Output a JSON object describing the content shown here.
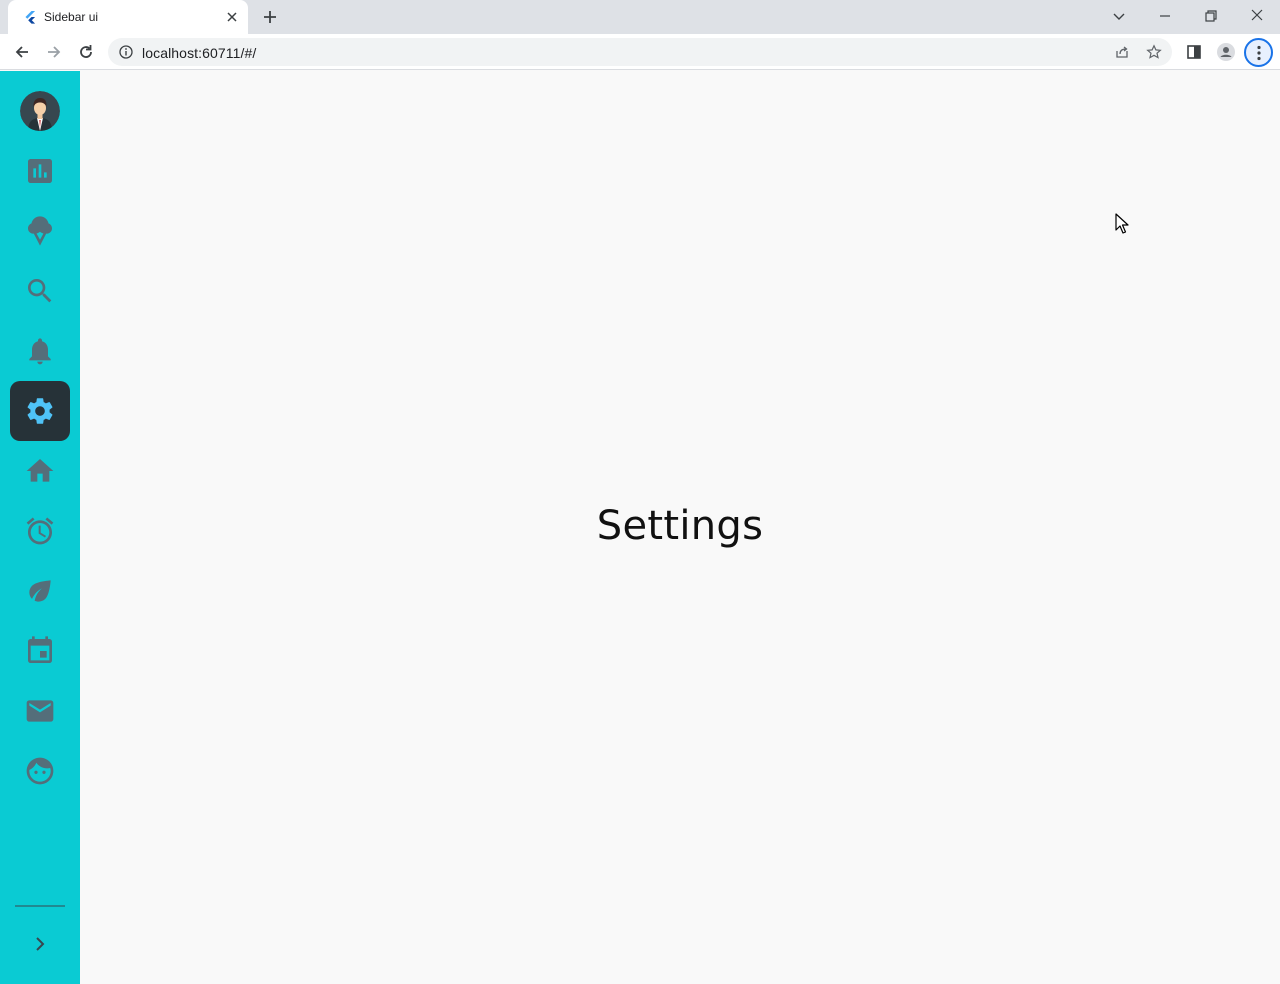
{
  "browser": {
    "tab_title": "Sidebar ui",
    "url": "localhost:60711/#/"
  },
  "sidebar": {
    "items": [
      {
        "name": "analytics",
        "icon": "bar-chart-icon",
        "active": false
      },
      {
        "name": "ice-cream",
        "icon": "ice-cream-icon",
        "active": false
      },
      {
        "name": "search",
        "icon": "search-icon",
        "active": false
      },
      {
        "name": "notifications",
        "icon": "bell-icon",
        "active": false
      },
      {
        "name": "settings",
        "icon": "gear-icon",
        "active": true
      },
      {
        "name": "home",
        "icon": "home-icon",
        "active": false
      },
      {
        "name": "alarm",
        "icon": "alarm-icon",
        "active": false
      },
      {
        "name": "eco",
        "icon": "leaf-icon",
        "active": false
      },
      {
        "name": "calendar",
        "icon": "calendar-icon",
        "active": false
      },
      {
        "name": "mail",
        "icon": "mail-icon",
        "active": false
      },
      {
        "name": "face",
        "icon": "face-icon",
        "active": false
      }
    ],
    "expand_icon": "chevron-right-icon",
    "colors": {
      "background": "#0acbd3",
      "icon": "#546e7a",
      "active_bg": "#263238",
      "active_icon": "#4fc3f7"
    }
  },
  "main": {
    "title": "Settings"
  }
}
